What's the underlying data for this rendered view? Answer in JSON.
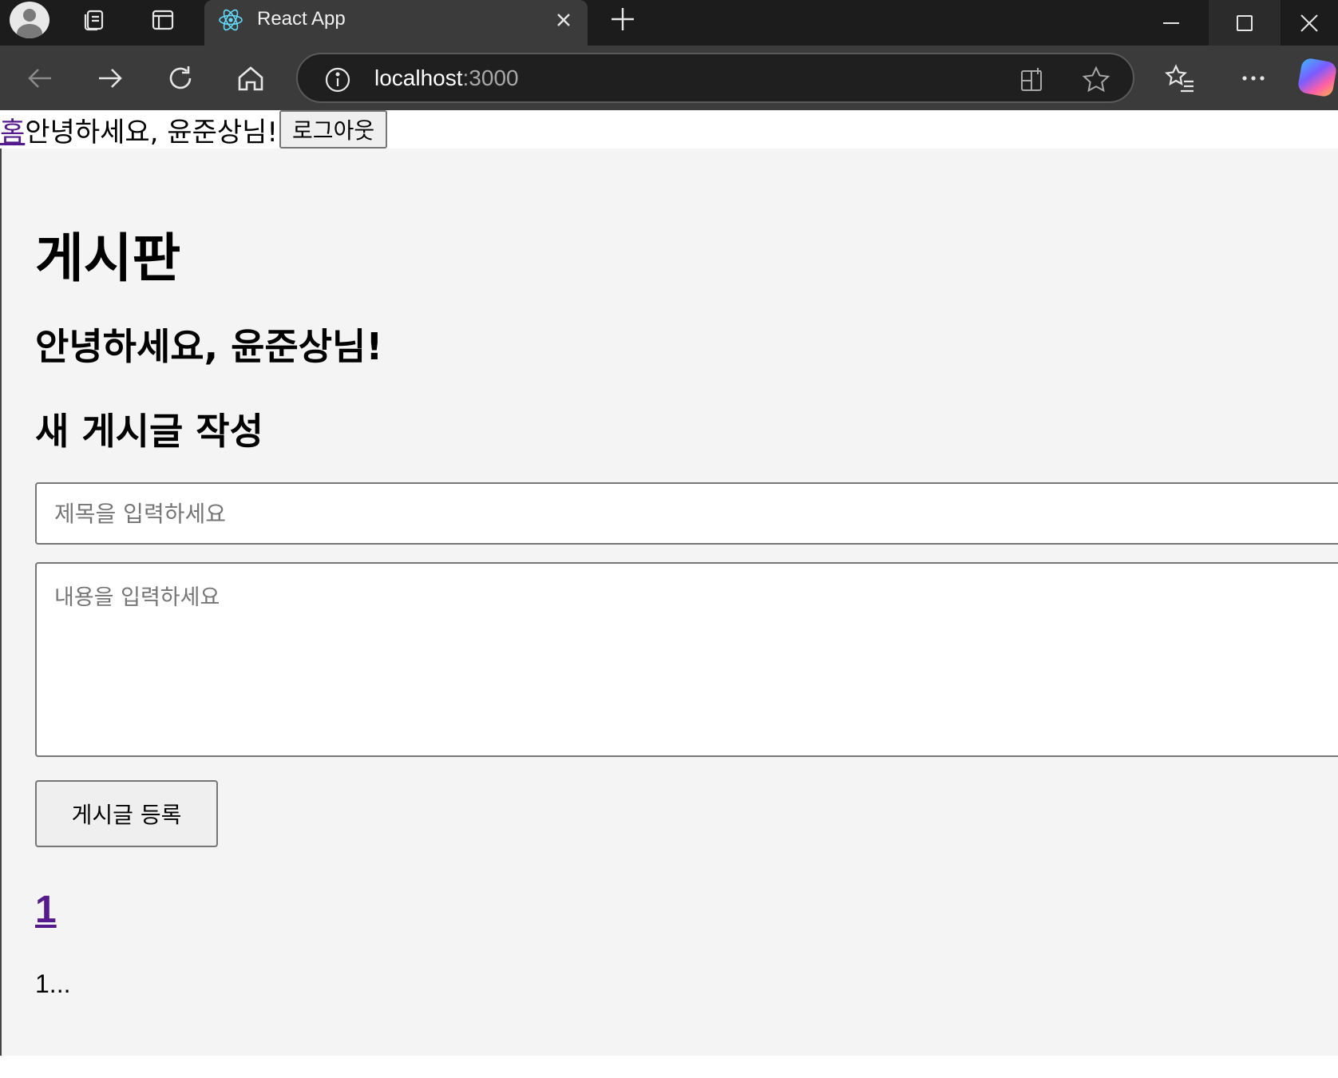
{
  "browser": {
    "tab_title": "React App",
    "url_host": "localhost",
    "url_port": ":3000",
    "colors": {
      "titlebar": "#1c1c1c",
      "toolbar": "#3b3b3b",
      "react_logo": "#61dafb"
    }
  },
  "nav": {
    "home_link": "홈",
    "greeting": "안녕하세요, 윤준상님!",
    "logout_label": "로그아웃"
  },
  "page": {
    "title": "게시판",
    "greeting": "안녕하세요, 윤준상님!",
    "new_post_heading": "새 게시글 작성",
    "title_placeholder": "제목을 입력하세요",
    "content_placeholder": "내용을 입력하세요",
    "submit_label": "게시글 등록"
  },
  "posts": [
    {
      "title": "1",
      "excerpt": "1..."
    }
  ],
  "colors": {
    "link": "#551a8b",
    "page_bg": "#f4f4f4"
  }
}
